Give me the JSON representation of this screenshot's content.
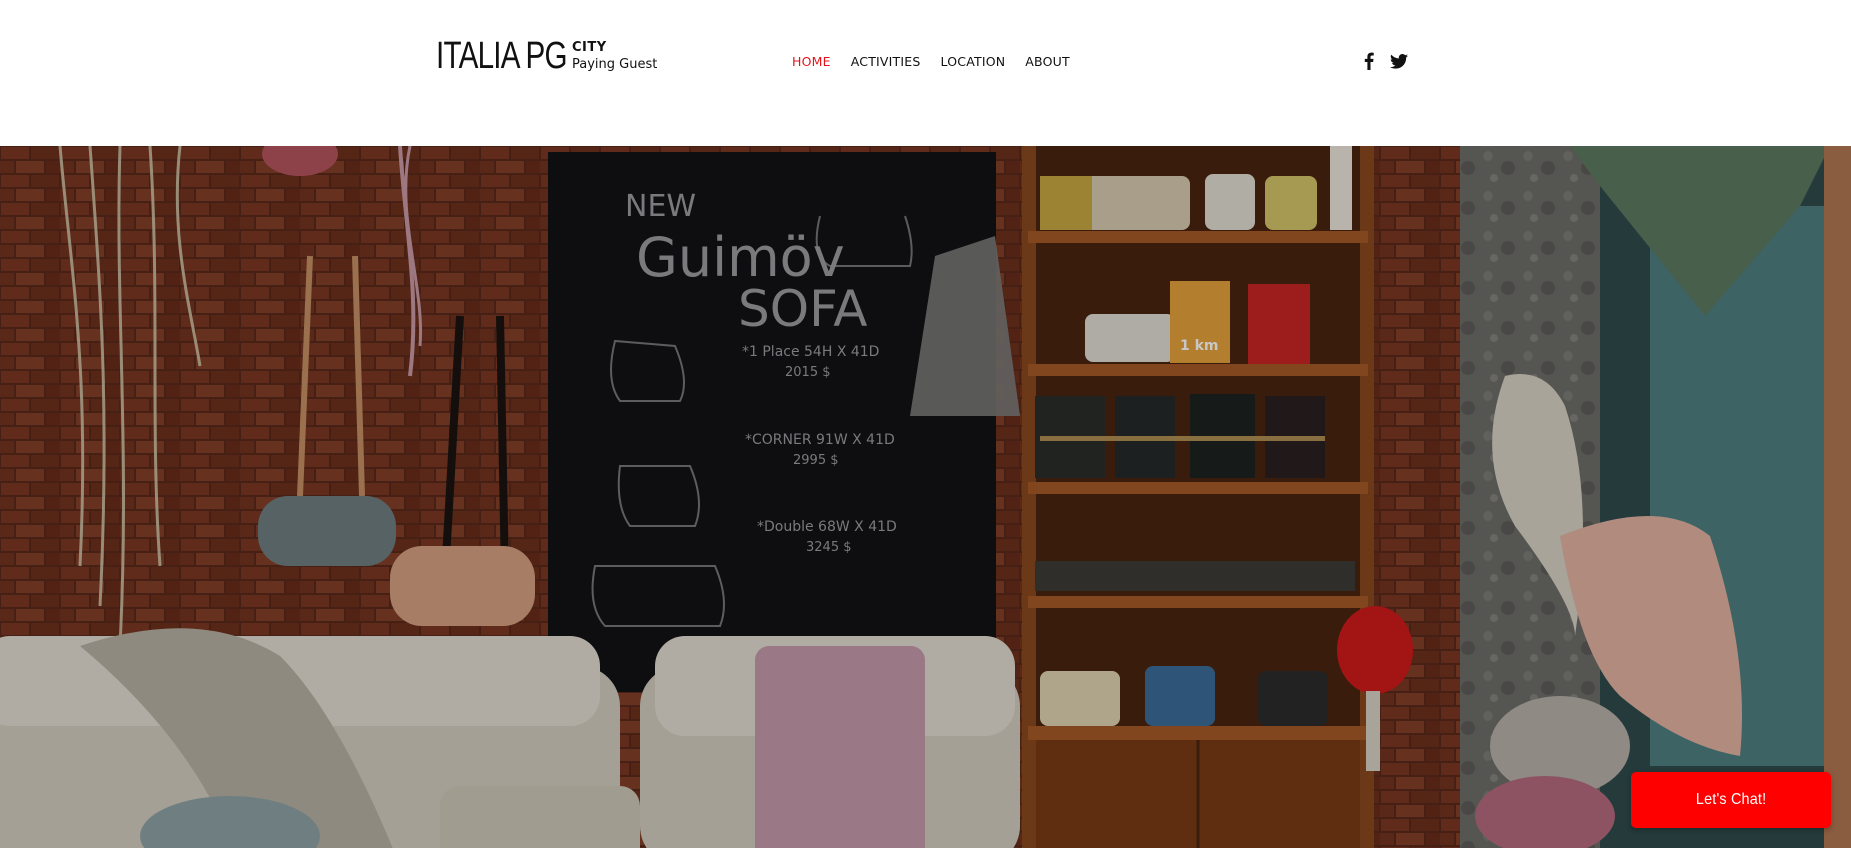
{
  "header": {
    "logo": {
      "main": "ITALIA PG",
      "sub_line1": "CITY",
      "sub_line2": "Paying Guest"
    },
    "nav": [
      {
        "label": "HOME",
        "active": true
      },
      {
        "label": "ACTIVITIES",
        "active": false
      },
      {
        "label": "LOCATION",
        "active": false
      },
      {
        "label": "ABOUT",
        "active": false
      }
    ],
    "social": [
      {
        "icon": "facebook-icon"
      },
      {
        "icon": "twitter-icon"
      }
    ]
  },
  "hero": {
    "image": "furniture-store-interior",
    "chalkboard": {
      "line1": "NEW",
      "line2": "Guimöv",
      "line3": "SOFA",
      "item1": "*1 Place 54H X 41D",
      "item1_price": "2015 $",
      "item2": "*CORNER 91W X 41D",
      "item2_price": "2995 $",
      "item3": "*Double 68W X 41D",
      "item3_price": "3245 $"
    },
    "book_label": "1 km"
  },
  "chat": {
    "label": "Let's Chat!"
  },
  "colors": {
    "accent": "#e4141b",
    "chat": "#ff0000",
    "text": "#111111"
  }
}
